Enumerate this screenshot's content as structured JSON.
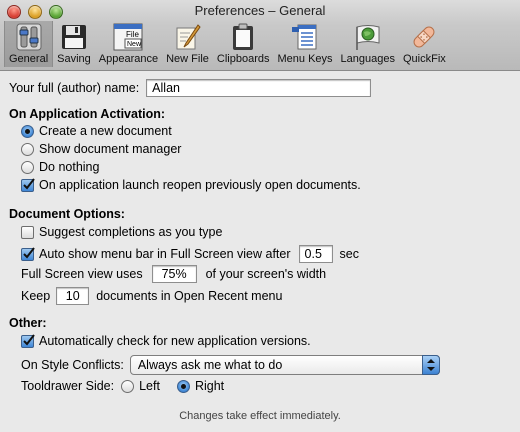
{
  "window": {
    "title": "Preferences – General"
  },
  "toolbar": {
    "items": [
      {
        "label": "General",
        "icon": "switches-icon"
      },
      {
        "label": "Saving",
        "icon": "floppy-disk-icon"
      },
      {
        "label": "Appearance",
        "icon": "file-new-appearance-icon"
      },
      {
        "label": "New File",
        "icon": "quill-pen-icon"
      },
      {
        "label": "Clipboards",
        "icon": "clipboard-icon"
      },
      {
        "label": "Menu Keys",
        "icon": "menu-keys-icon"
      },
      {
        "label": "Languages",
        "icon": "globe-flag-icon"
      },
      {
        "label": "QuickFix",
        "icon": "bandage-icon"
      }
    ],
    "appearance_icon_text": {
      "top": "File",
      "bottom": "New"
    }
  },
  "author": {
    "label": "Your full (author) name:",
    "value": "Allan"
  },
  "activation": {
    "heading": "On Application Activation:",
    "options": [
      "Create a new document",
      "Show document manager",
      "Do nothing"
    ],
    "selected_index": 0,
    "reopen_label": "On application launch reopen previously open documents.",
    "reopen_checked": true
  },
  "document": {
    "heading": "Document Options:",
    "suggest_label": "Suggest completions as you type",
    "suggest_checked": false,
    "autoshow_label": "Auto show menu bar in Full Screen view after",
    "autoshow_checked": true,
    "autoshow_value": "0.5",
    "autoshow_unit": "sec",
    "fullscreen_prefix": "Full Screen view uses",
    "fullscreen_value": "75%",
    "fullscreen_suffix": "of your screen's width",
    "recent_prefix": "Keep",
    "recent_value": "10",
    "recent_suffix": "documents in Open Recent menu"
  },
  "other": {
    "heading": "Other:",
    "autocheck_label": "Automatically check for new application versions.",
    "autocheck_checked": true,
    "conflicts_label": "On Style Conflicts:",
    "conflicts_value": "Always ask me what to do",
    "tooldrawer_label": "Tooldrawer Side:",
    "tooldrawer_options": [
      "Left",
      "Right"
    ],
    "tooldrawer_selected": 1
  },
  "footer": {
    "note": "Changes take effect immediately."
  },
  "colors": {
    "accent": "#3f86d6",
    "toolbar_selected": "#a4a4a4"
  }
}
